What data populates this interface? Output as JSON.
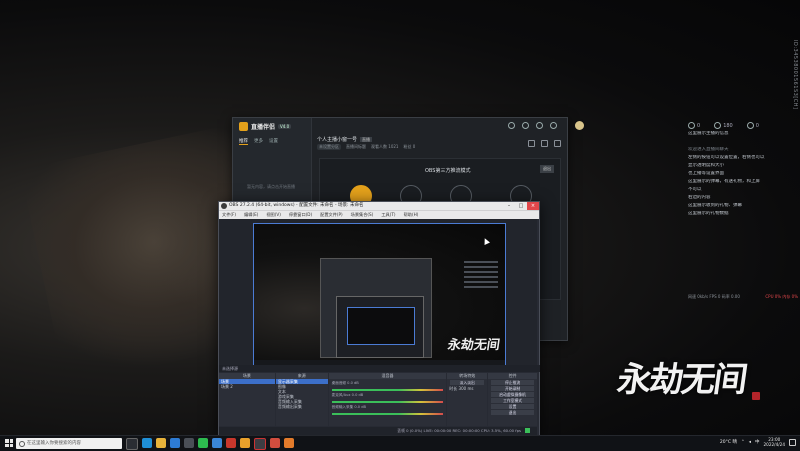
{
  "desktop": {
    "id_text": "ID:34538001561S3[CH]",
    "logo_text": "永劫无间"
  },
  "chat": {
    "stats": [
      "0",
      "180",
      "0"
    ],
    "lines": [
      "这里展示主播的信息",
      "",
      "",
      "",
      "",
      "欢迎进入直播间聊天",
      "左侧的按钮可以设置位置，右侧也可以",
      "显示透明度和大小",
      "也上播等设置界面",
      "这里展示的弹幕，有送礼物，和上屏",
      "不可以",
      "右边的内容",
      "这里展示收到的礼物、弹幕",
      "这里展示的礼物数据"
    ],
    "bottom_left": "网速 0kb/s  FPS 0  码率 0.00",
    "bottom_red": "CPU 0%  内存 0%"
  },
  "back_window": {
    "app_name": "直播伴侣",
    "version": "V4.0",
    "tabs": [
      "推荐",
      "更多",
      "设置"
    ],
    "hint": "暂无内容，请点击开始直播",
    "title": "个人主播小窗一号",
    "title_tag": "直播",
    "sub_items": [
      "未设置分区",
      "直播间标题",
      "观看人数 1021",
      "粉丝 0"
    ],
    "card_title": "OBS第三方推流模式",
    "card_close": "退出",
    "node_labels": [
      "开始",
      "推流 URL",
      "推流码",
      "完成"
    ]
  },
  "obs": {
    "title": "OBS 27.2.4 (64-bit, windows) - 配置文件: 未命名 - 场景: 未命名",
    "menu": [
      "文件(F)",
      "编辑(E)",
      "视图(V)",
      "停靠窗口(D)",
      "配置文件(P)",
      "场景集合(S)",
      "工具(T)",
      "帮助(H)"
    ],
    "bar": "未选择源",
    "docks": {
      "scenes_header": "场景",
      "scenes": [
        "场景",
        "场景 2"
      ],
      "sources_header": "来源",
      "sources": [
        "显示器采集",
        "图像",
        "文本",
        "游戏采集",
        "音频输入采集",
        "音频输出采集"
      ],
      "mixer_header": "混音器",
      "mixer": [
        {
          "label": "桌面音频 0.0 dB"
        },
        {
          "label": "麦克风/Aux 0.0 dB"
        },
        {
          "label": "音频输入采集 0.0 dB"
        }
      ],
      "trans_header": "转场特效",
      "trans_items": [
        "淡入淡出",
        "时长 300 ms"
      ],
      "ctrl_header": "控件",
      "controls": [
        "停止推流",
        "开始录制",
        "启动虚拟摄像机",
        "工作室模式",
        "设置",
        "退出"
      ]
    },
    "status": "丢帧 0 (0.0%)  LIVE: 00:00:00  REC: 00:00:00  CPU: 3.5%, 60.00 fps"
  },
  "taskbar": {
    "search_placeholder": "在这里输入你要搜索的内容",
    "tray_text": "20°C  晴",
    "time": "23:00",
    "date": "2022/4/24"
  }
}
